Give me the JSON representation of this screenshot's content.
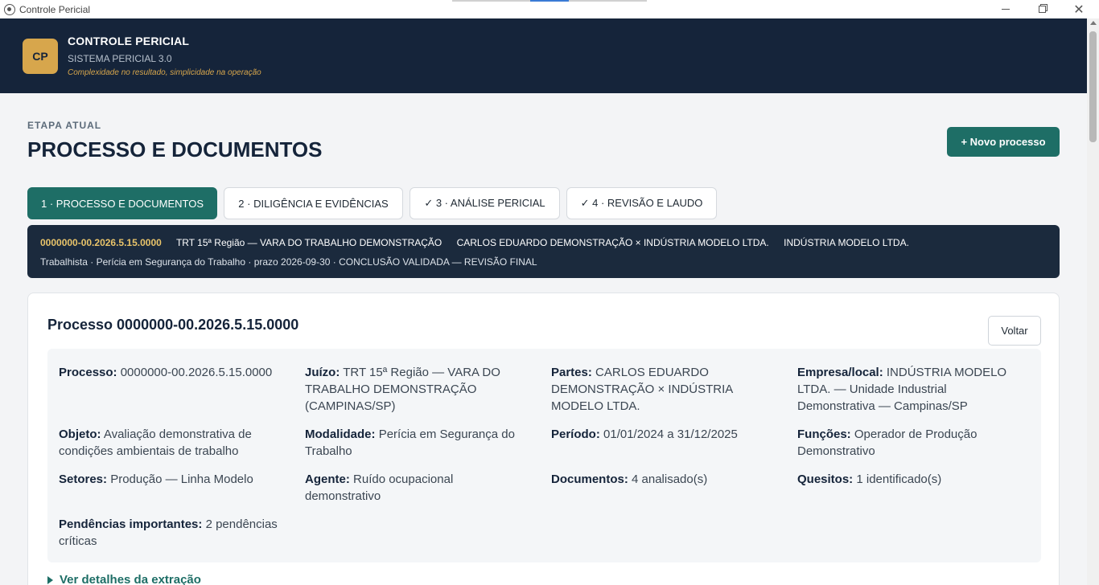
{
  "window": {
    "title": "Controle Pericial"
  },
  "header": {
    "logo": "CP",
    "title": "CONTROLE PERICIAL",
    "subtitle": "SISTEMA PERICIAL 3.0",
    "tagline": "Complexidade no resultado, simplicidade na operação"
  },
  "stage": {
    "label": "ETAPA ATUAL",
    "title": "PROCESSO E DOCUMENTOS",
    "new_button": "+ Novo processo"
  },
  "tabs": [
    {
      "label": "1 · PROCESSO E DOCUMENTOS"
    },
    {
      "label": "2 · DILIGÊNCIA E EVIDÊNCIAS"
    },
    {
      "label": "✓ 3 · ANÁLISE PERICIAL"
    },
    {
      "label": "✓ 4 · REVISÃO E LAUDO"
    }
  ],
  "summary": {
    "process_number": "0000000-00.2026.5.15.0000",
    "court": "TRT 15ª Região — VARA DO TRABALHO DEMONSTRAÇÃO",
    "parties": "CARLOS EDUARDO DEMONSTRAÇÃO × INDÚSTRIA MODELO LTDA.",
    "company": "INDÚSTRIA MODELO LTDA.",
    "details": "Trabalhista · Perícia em Segurança do Trabalho · prazo 2026-09-30 · CONCLUSÃO VALIDADA — REVISÃO FINAL"
  },
  "card": {
    "title": "Processo 0000000-00.2026.5.15.0000",
    "back_button": "Voltar",
    "expand_label": "Ver detalhes da extração",
    "fields": [
      {
        "label": "Processo:",
        "value": "0000000-00.2026.5.15.0000"
      },
      {
        "label": "Juízo:",
        "value": "TRT 15ª Região — VARA DO TRABALHO DEMONSTRAÇÃO (CAMPINAS/SP)"
      },
      {
        "label": "Partes:",
        "value": "CARLOS EDUARDO DEMONSTRAÇÃO × INDÚSTRIA MODELO LTDA."
      },
      {
        "label": "Empresa/local:",
        "value": "INDÚSTRIA MODELO LTDA. — Unidade Industrial Demonstrativa — Campinas/SP"
      },
      {
        "label": "Objeto:",
        "value": "Avaliação demonstrativa de condições ambientais de trabalho"
      },
      {
        "label": "Modalidade:",
        "value": "Perícia em Segurança do Trabalho"
      },
      {
        "label": "Período:",
        "value": "01/01/2024 a 31/12/2025"
      },
      {
        "label": "Funções:",
        "value": "Operador de Produção Demonstrativo"
      },
      {
        "label": "Setores:",
        "value": "Produção — Linha Modelo"
      },
      {
        "label": "Agente:",
        "value": "Ruído ocupacional demonstrativo"
      },
      {
        "label": "Documentos:",
        "value": "4 analisado(s)"
      },
      {
        "label": "Quesitos:",
        "value": "1 identificado(s)"
      },
      {
        "label": "Pendências importantes:",
        "value": "2 pendências críticas"
      }
    ]
  }
}
